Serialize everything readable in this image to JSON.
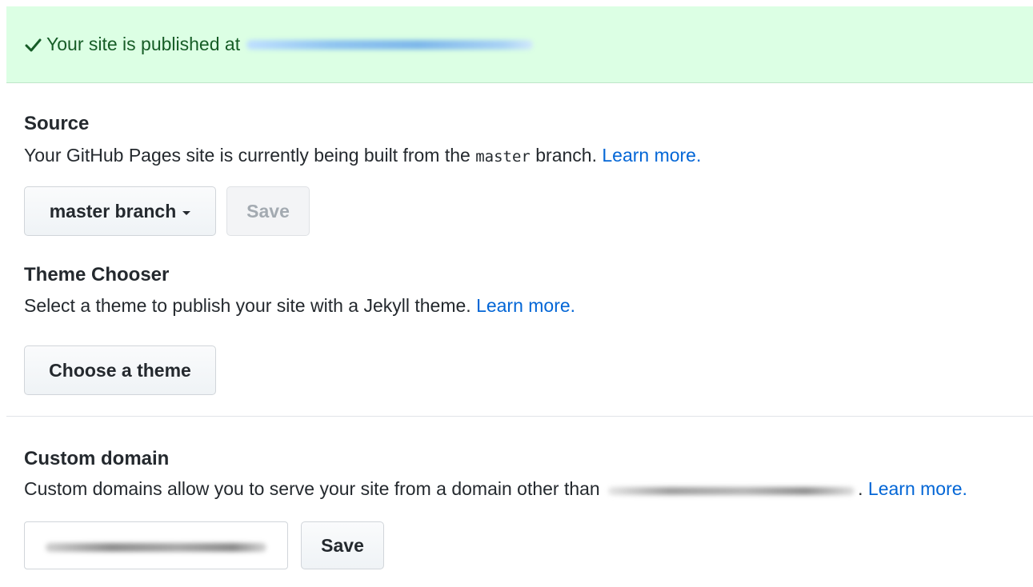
{
  "flash": {
    "message": "Your site is published at",
    "icon": "check-icon",
    "color": "#165c26"
  },
  "source": {
    "title": "Source",
    "description_prefix": "Your GitHub Pages site is currently being built from the",
    "branch_code": "master",
    "description_suffix": "branch.",
    "learn_more": "Learn more.",
    "branch_select_label": "master branch",
    "save_label": "Save"
  },
  "theme": {
    "title": "Theme Chooser",
    "description": "Select a theme to publish your site with a Jekyll theme.",
    "learn_more": "Learn more.",
    "choose_label": "Choose a theme"
  },
  "custom_domain": {
    "title": "Custom domain",
    "description": "Custom domains allow you to serve your site from a domain other than",
    "period": ".",
    "learn_more": "Learn more.",
    "save_label": "Save"
  },
  "colors": {
    "link": "#0366d6",
    "flash_bg": "#dcffe4"
  }
}
